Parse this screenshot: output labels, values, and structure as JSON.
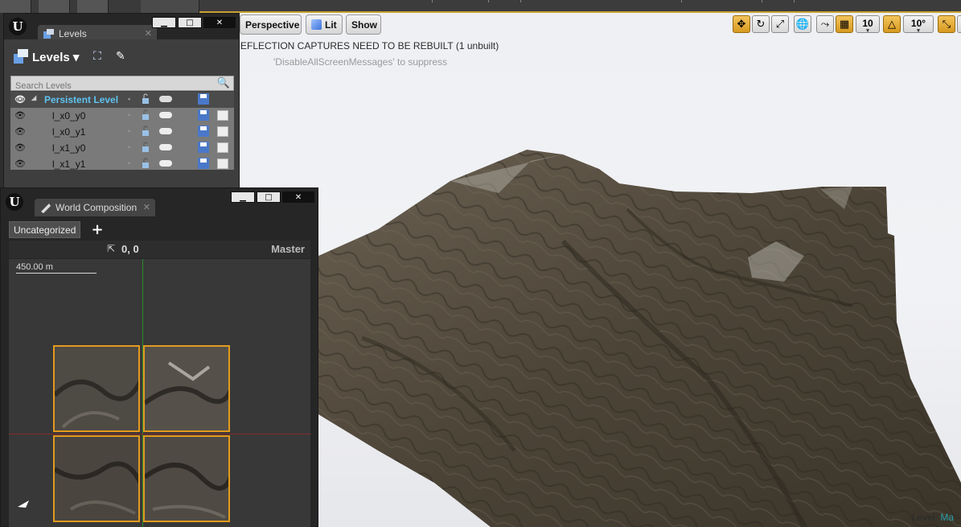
{
  "viewport": {
    "perspective_label": "Perspective",
    "lit_label": "Lit",
    "show_label": "Show",
    "grid_snap_value": "10",
    "rotation_snap_value": "10°",
    "warning_text": "EFLECTION CAPTURES NEED TO BE REBUILT (1 unbuilt)",
    "suppress_text": "'DisableAllScreenMessages' to suppress",
    "level_label": "Level:",
    "level_value": "Ma"
  },
  "levels_panel": {
    "tab_title": "Levels",
    "header_label": "Levels",
    "search_placeholder": "Search Levels",
    "rows": [
      {
        "name": "Persistent Level"
      },
      {
        "name": "l_x0_y0"
      },
      {
        "name": "l_x0_y1"
      },
      {
        "name": "l_x1_y0"
      },
      {
        "name": "l_x1_y1"
      }
    ]
  },
  "world_composition": {
    "tab_title": "World Composition",
    "category_label": "Uncategorized",
    "add_label": "+",
    "coordinates": "0, 0",
    "master_label": "Master",
    "scale_label": "450.00 m"
  },
  "window_buttons": {
    "minimize": "▁",
    "maximize": "□",
    "close": "✕"
  },
  "colors": {
    "accent": "#e39a1d",
    "persistent_level": "#5ec3f0",
    "panel_bg": "#3e3e3e"
  }
}
